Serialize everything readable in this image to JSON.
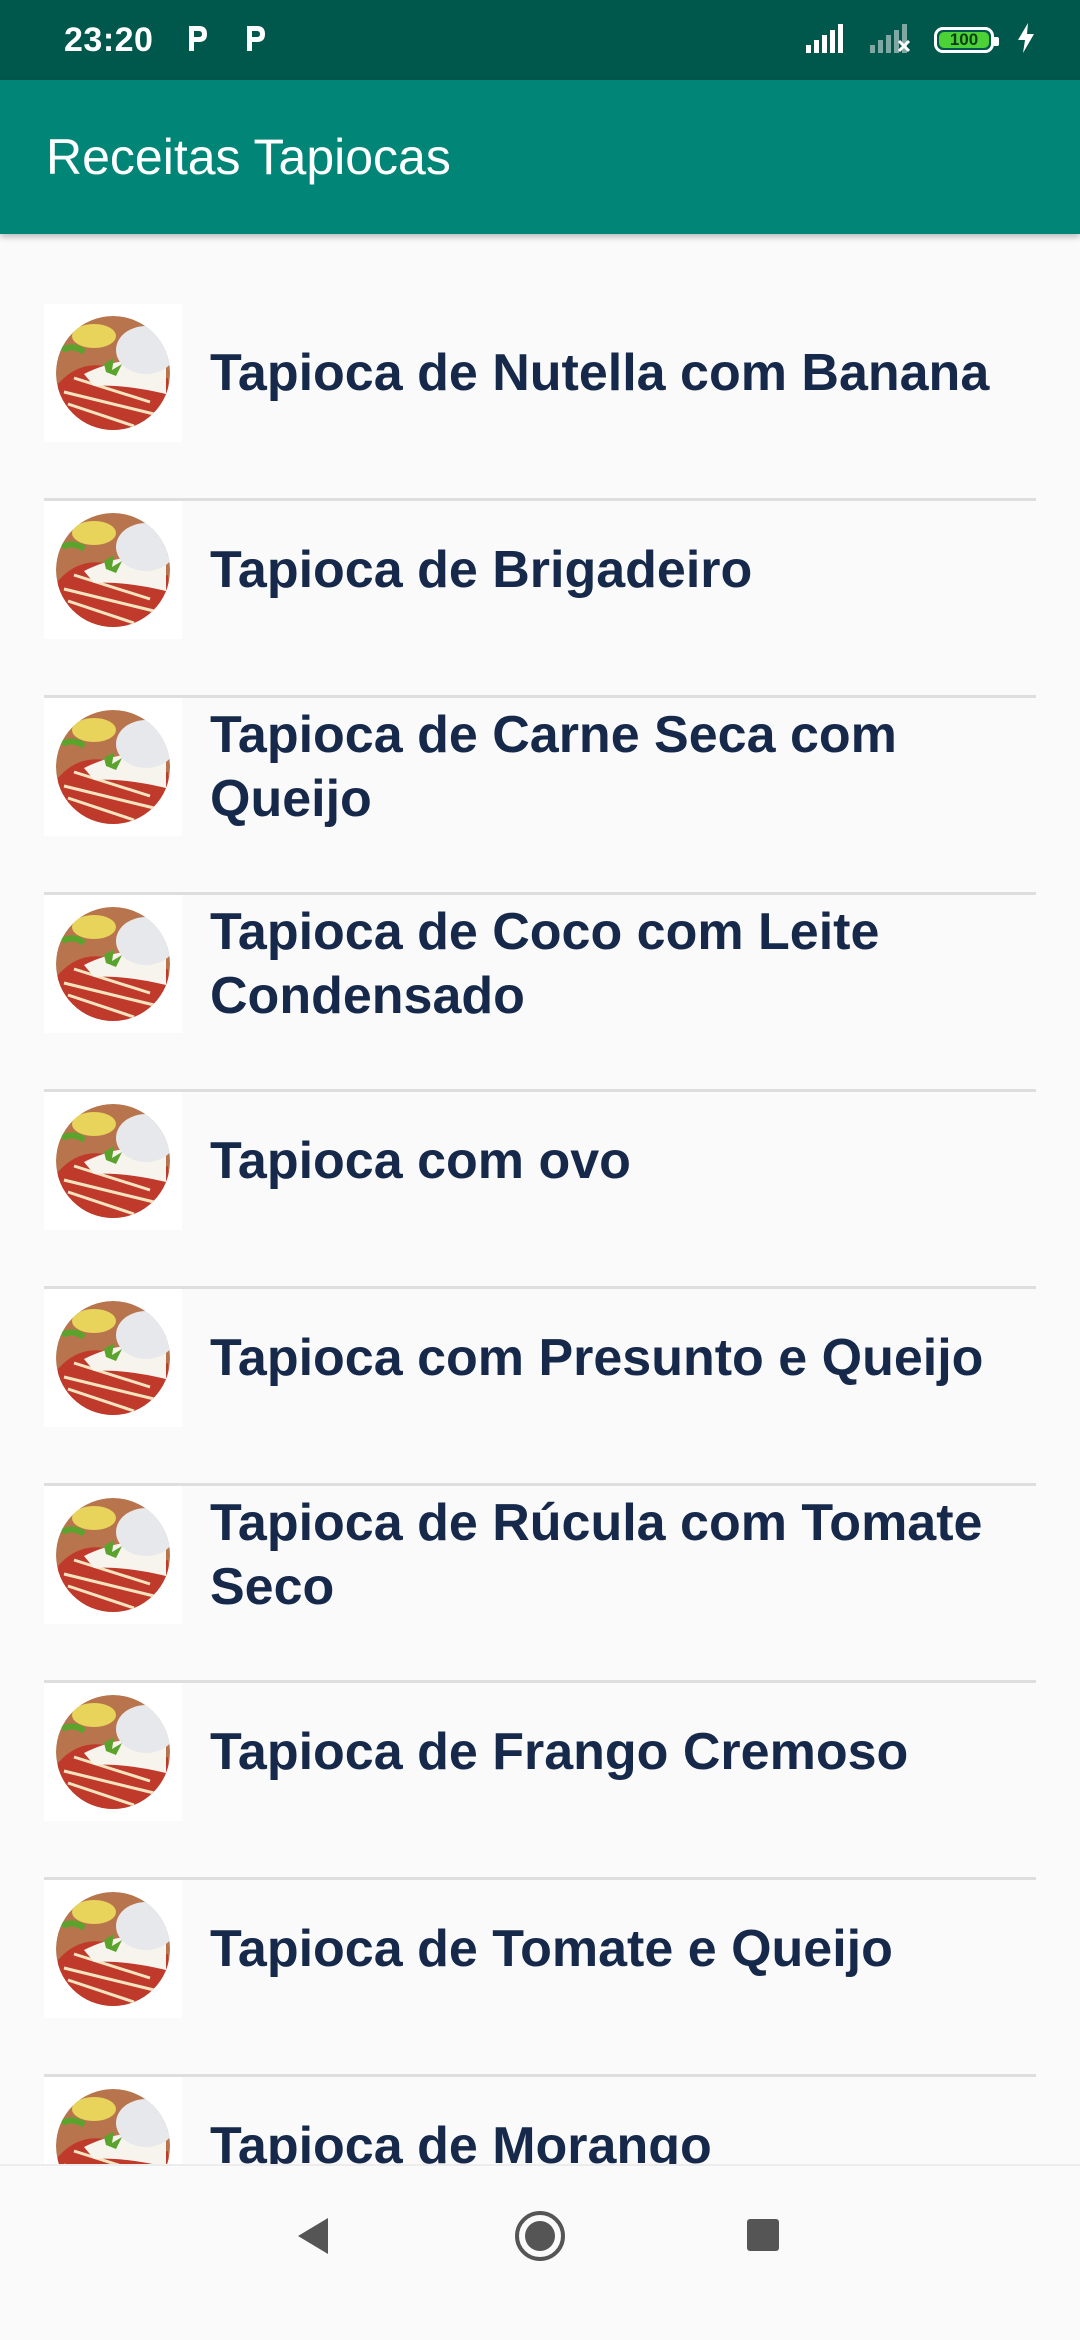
{
  "status_bar": {
    "time": "23:20",
    "notification_icons": [
      "parking-p-icon",
      "parking-p-icon"
    ],
    "battery_level": "100",
    "signal_icons": [
      "signal-full-icon",
      "signal-empty-icon"
    ],
    "charging_icon": "lightning-icon"
  },
  "app_bar": {
    "title": "Receitas Tapiocas",
    "color": "#008577"
  },
  "recipes": [
    {
      "label": "Tapioca de Nutella com Banana"
    },
    {
      "label": "Tapioca de Brigadeiro"
    },
    {
      "label": "Tapioca de Carne Seca com Queijo"
    },
    {
      "label": "Tapioca de Coco com Leite Condensado"
    },
    {
      "label": "Tapioca com ovo"
    },
    {
      "label": "Tapioca com Presunto e Queijo"
    },
    {
      "label": "Tapioca de Rúcula com Tomate Seco"
    },
    {
      "label": "Tapioca de Frango Cremoso"
    },
    {
      "label": "Tapioca de Tomate e Queijo"
    },
    {
      "label": "Tapioca de Morango"
    }
  ],
  "nav_bar": {
    "buttons": [
      "back-icon",
      "home-icon",
      "recents-icon"
    ]
  },
  "colors": {
    "status_bar": "#00574b",
    "app_bar": "#008577",
    "text": "#16294a"
  }
}
